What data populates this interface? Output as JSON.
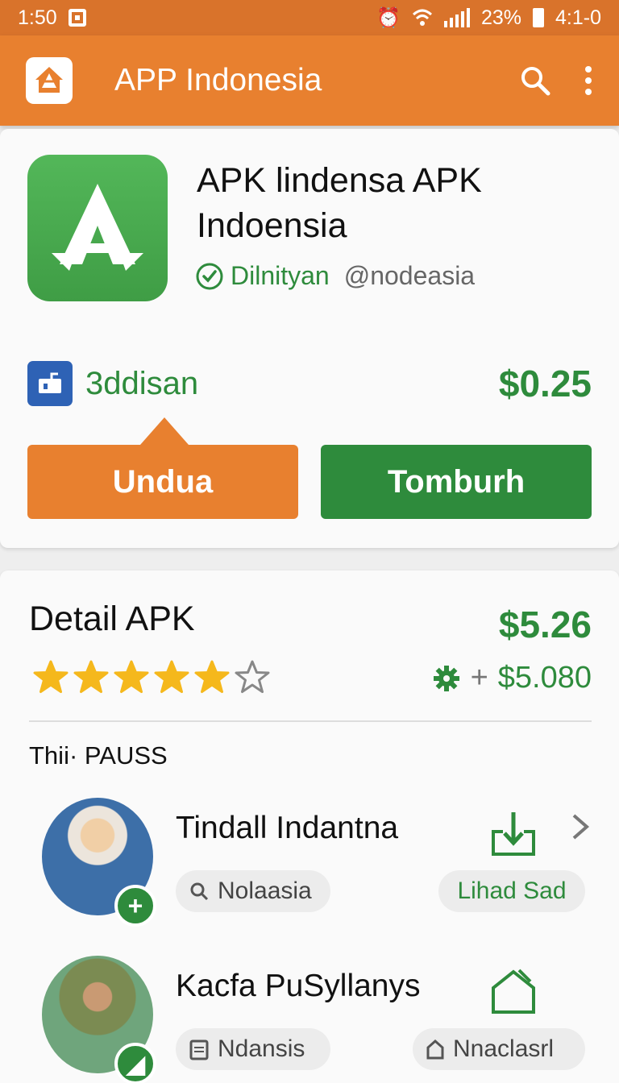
{
  "status_bar": {
    "time": "1:50",
    "battery_percent": "23%",
    "clock_right": "4:1-0"
  },
  "app_bar": {
    "title": "APP Indonesia"
  },
  "app_card": {
    "title": "APK lindensa APK Indoensia",
    "verified_name": "Dilnityan",
    "handle": "@nodeasia",
    "developer": "3ddisan",
    "price": "$0.25",
    "primary_button": "Undua",
    "secondary_button": "Tomburh"
  },
  "detail": {
    "title": "Detail APK",
    "price": "$5.26",
    "rating": 5,
    "rating_max": 6,
    "sub_price": "$5.080",
    "section_label": "Thii· PAUSS",
    "items": [
      {
        "name": "Tindall Indantna",
        "tag": "Nolaasia",
        "action_label": "Lihad Sad"
      },
      {
        "name": "Kacfa PuSyllanys",
        "tag": "Ndansis",
        "action_label": "Nnaclasrl"
      }
    ]
  },
  "colors": {
    "orange": "#e8802f",
    "green": "#2e8b3c",
    "blue": "#2e62b5",
    "star": "#f5b81c"
  }
}
